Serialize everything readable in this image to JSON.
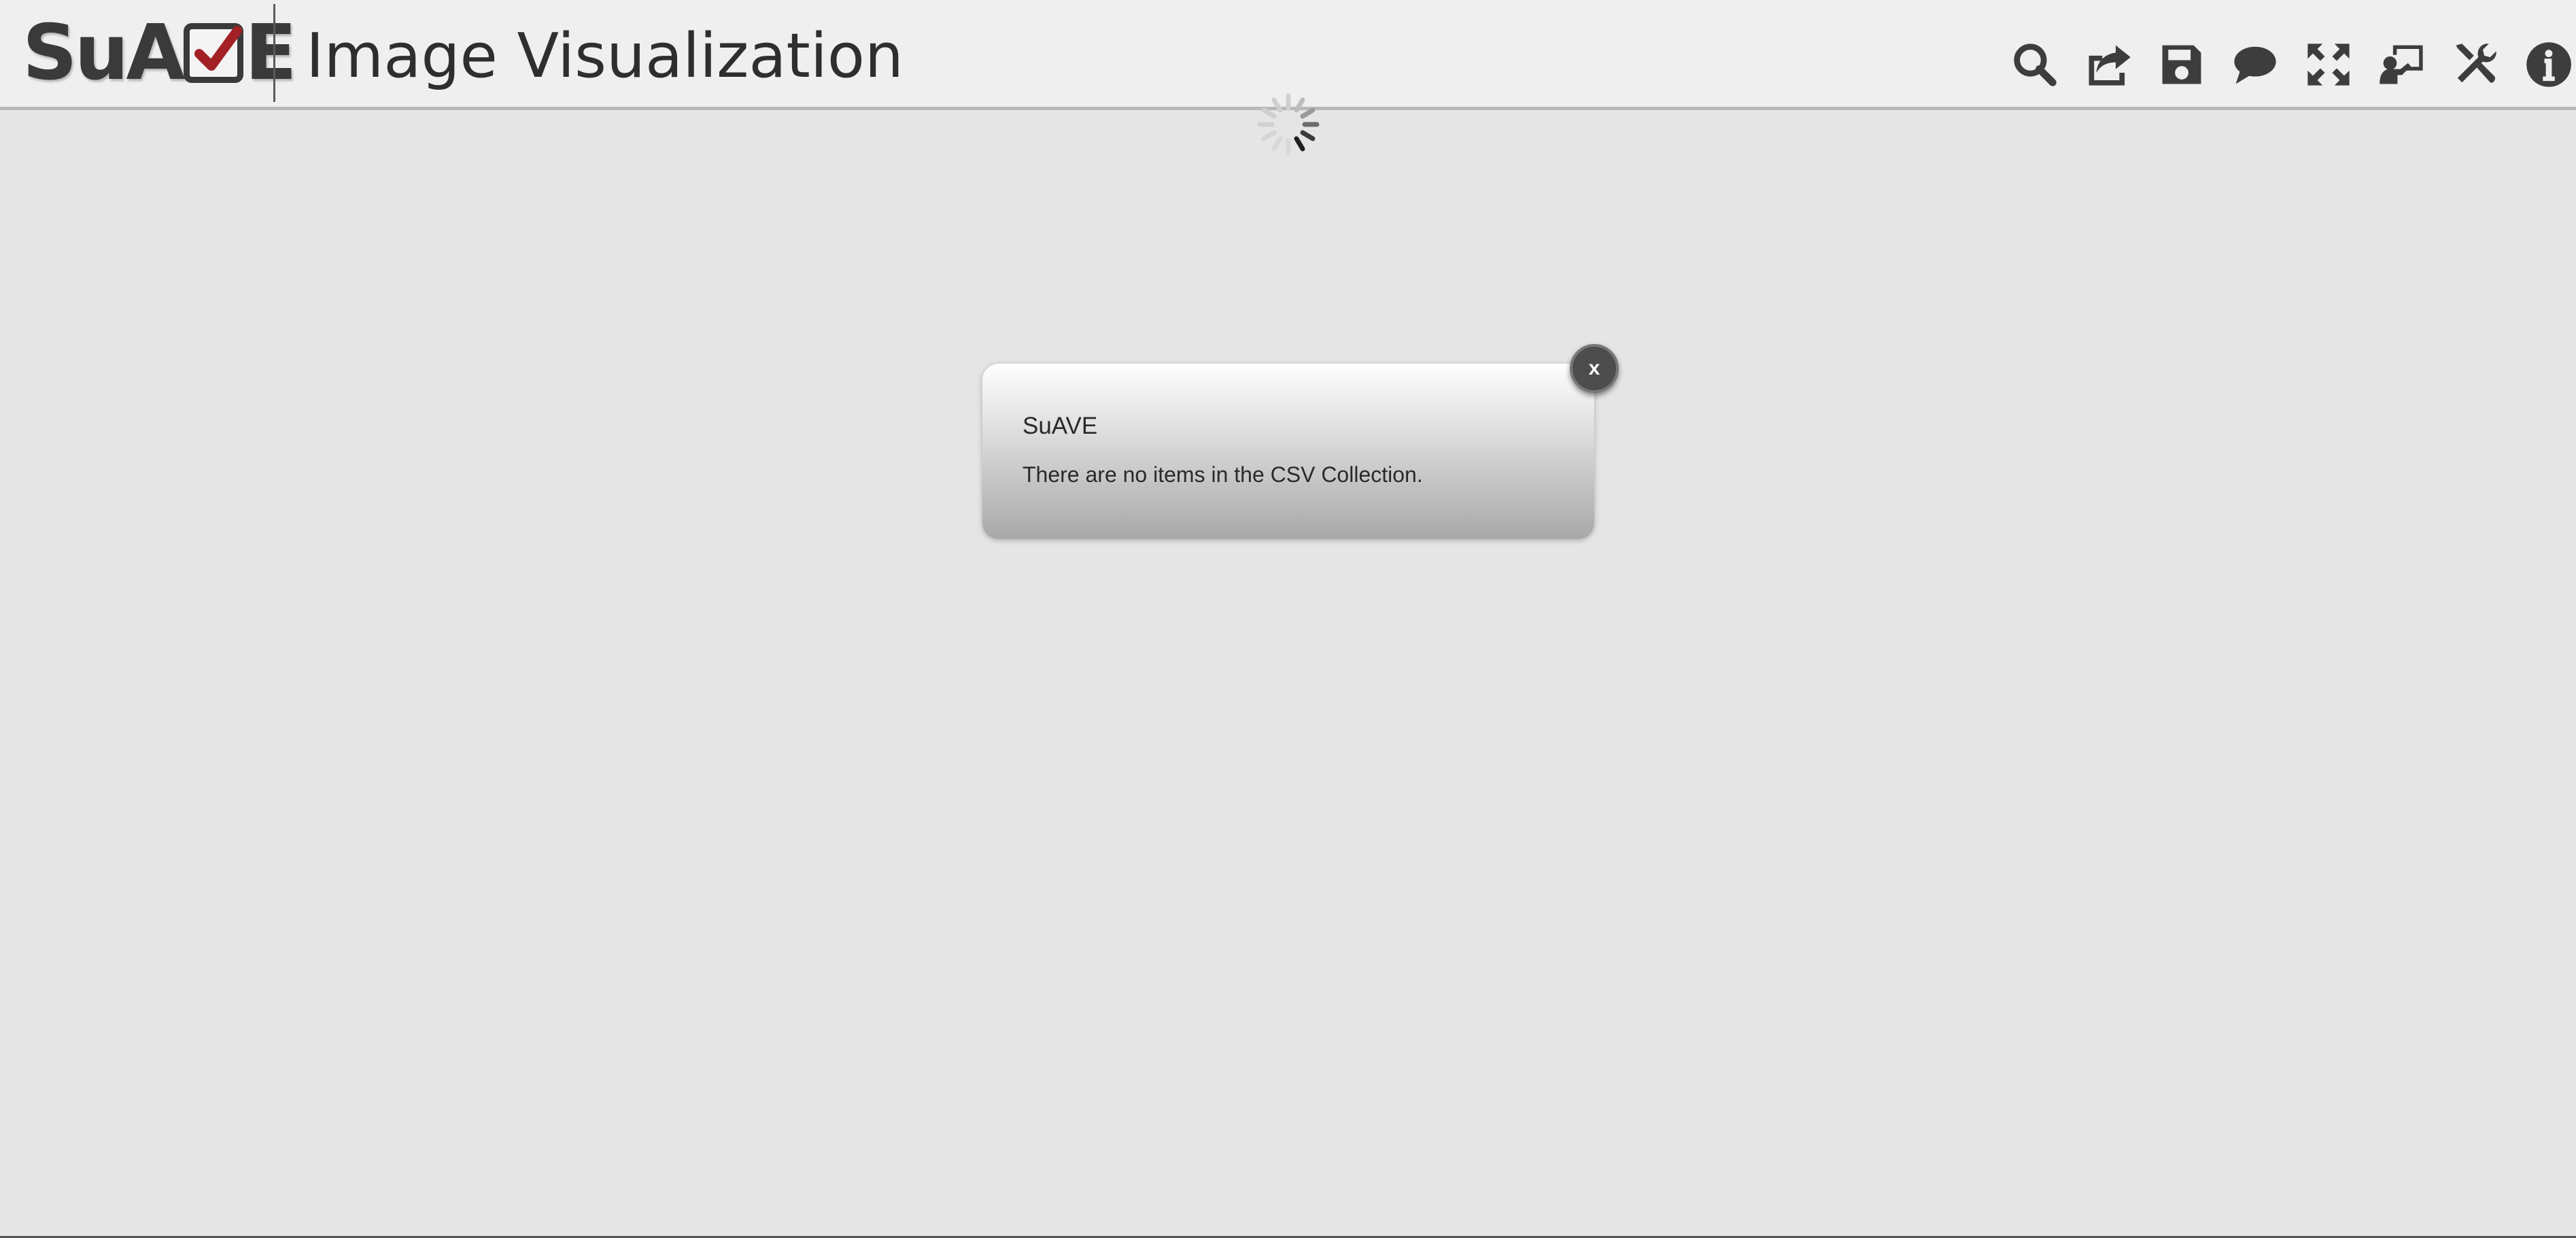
{
  "header": {
    "logo_text_left": "SuA",
    "logo_text_right": "E",
    "logo_check_color": "#a32024",
    "title": "Image Visualization"
  },
  "toolbar": {
    "icons": [
      "search-icon",
      "share-icon",
      "save-icon",
      "comment-icon",
      "fullscreen-icon",
      "presentation-icon",
      "tools-icon",
      "info-icon"
    ]
  },
  "loading": {
    "icon": "spinner-icon"
  },
  "dialog": {
    "title": "SuAVE",
    "message": "There are no items in the CSV Collection.",
    "close_label": "x"
  }
}
